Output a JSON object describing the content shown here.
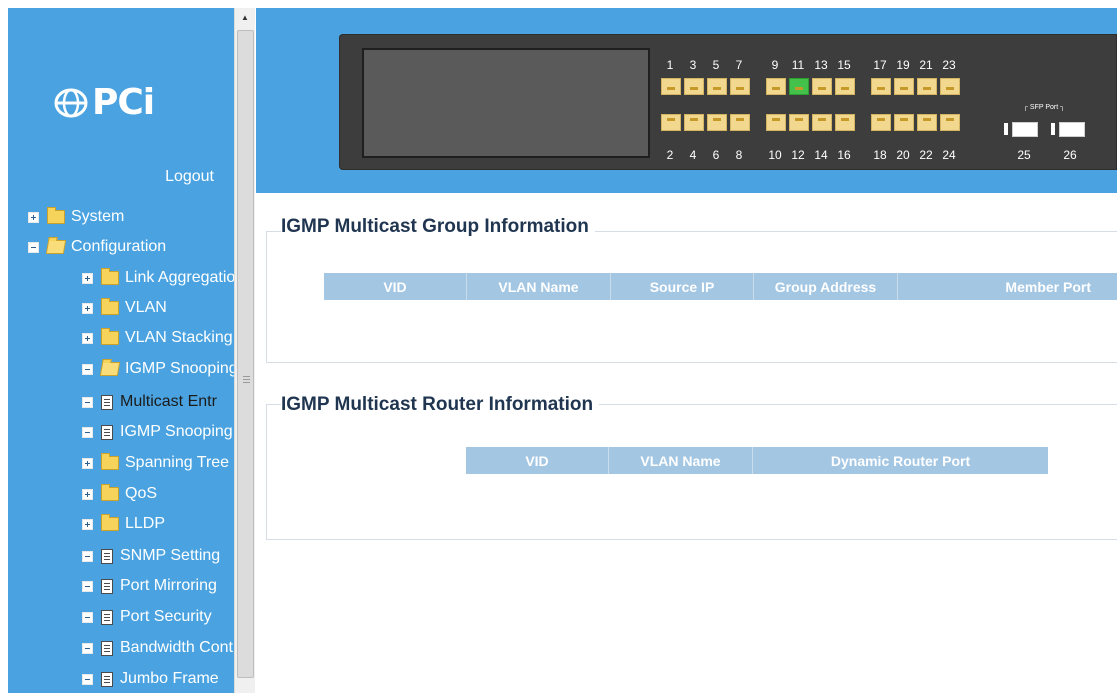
{
  "brand": {
    "logo_text": "PCi"
  },
  "sidebar": {
    "logout": "Logout",
    "items": [
      {
        "label": "System"
      },
      {
        "label": "Configuration"
      },
      {
        "label": "Link Aggregation"
      },
      {
        "label": "VLAN"
      },
      {
        "label": "VLAN Stacking"
      },
      {
        "label": "IGMP Snooping"
      },
      {
        "label": "Multicast Entr"
      },
      {
        "label": "IGMP Snooping"
      },
      {
        "label": "Spanning Tree"
      },
      {
        "label": "QoS"
      },
      {
        "label": "LLDP"
      },
      {
        "label": "SNMP Setting"
      },
      {
        "label": "Port Mirroring"
      },
      {
        "label": "Port Security"
      },
      {
        "label": "Bandwidth Control"
      },
      {
        "label": "Jumbo Frame"
      }
    ]
  },
  "switch_panel": {
    "odd_ports": [
      "1",
      "3",
      "5",
      "7",
      "9",
      "11",
      "13",
      "15",
      "17",
      "19",
      "21",
      "23"
    ],
    "even_ports": [
      "2",
      "4",
      "6",
      "8",
      "10",
      "12",
      "14",
      "16",
      "18",
      "20",
      "22",
      "24"
    ],
    "active_port": "11",
    "sfp_label": "SFP Port",
    "sfp_ports": [
      "25",
      "26"
    ],
    "colors": {
      "active": "#44c14a",
      "idle": "#f2d78e"
    }
  },
  "group_info": {
    "title": "IGMP Multicast Group Information",
    "columns": [
      "VID",
      "VLAN Name",
      "Source IP",
      "Group Address",
      "Member Port"
    ],
    "rows": []
  },
  "router_info": {
    "title": "IGMP Multicast Router Information",
    "columns": [
      "VID",
      "VLAN Name",
      "Dynamic Router Port"
    ],
    "rows": []
  },
  "colors": {
    "sidebar_bg": "#4aa3e0",
    "header_bg": "#4aa3e0",
    "table_header": "#a3c6e3",
    "title_text": "#1f3550"
  }
}
